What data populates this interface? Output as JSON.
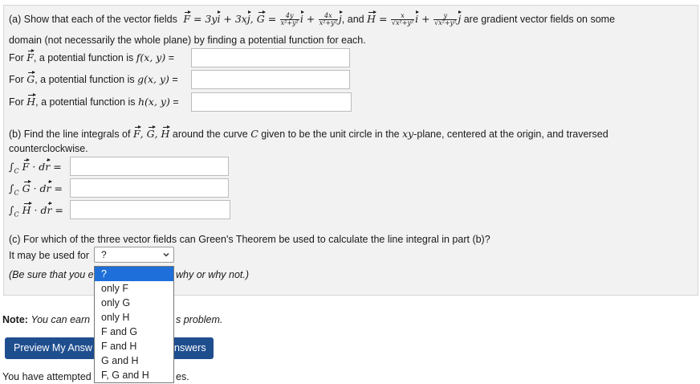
{
  "part_a": {
    "intro_1": "(a) Show that each of the vector fields",
    "F_def": "F = 3y i + 3x j, G =",
    "G_num1": "4y",
    "G_den1": "x²+y²",
    "G_num2": "4x",
    "G_den2": "x²+y²",
    "and_H": ", and H =",
    "H_num1": "x",
    "H_den1": "√x²+y²",
    "H_num2": "y",
    "H_den2": "√x²+y²",
    "intro_2": "are gradient vector fields on some",
    "intro_line2": "domain (not necessarily the whole plane) by finding a potential function for each.",
    "f_label": "For F, a potential function is f(x, y) =",
    "g_label": "For G, a potential function is g(x, y) =",
    "h_label": "For H, a potential function is h(x, y) ="
  },
  "part_b": {
    "intro": "(b) Find the line integrals of F, G, H around the curve C given to be the unit circle in the xy-plane, centered at the origin, and traversed",
    "intro_line2": "counterclockwise.",
    "intF": "∫C F · dr =",
    "intG": "∫C G · dr =",
    "intH": "∫C H · dr ="
  },
  "part_c": {
    "question": "(c) For which of the three vector fields can Green's Theorem be used to calculate the line integral in part (b)?",
    "used_for": "It may be used for",
    "selected": "?",
    "explain_prefix": "(Be sure that you e",
    "explain_suffix": "why or why not.)",
    "options": [
      "?",
      "only F",
      "only G",
      "only H",
      "F and G",
      "F and H",
      "G and H",
      "F, G and H"
    ]
  },
  "footer": {
    "note_label": "Note:",
    "note_prefix": "You can earn",
    "note_suffix": "s problem.",
    "preview_label": "Preview My Answ",
    "submit_label": "nswers",
    "attempted_prefix": "You have attempted",
    "attempted_suffix": "es."
  },
  "colors": {
    "accent_button": "#1f4e8f",
    "selected_option": "#1e6fd9"
  }
}
